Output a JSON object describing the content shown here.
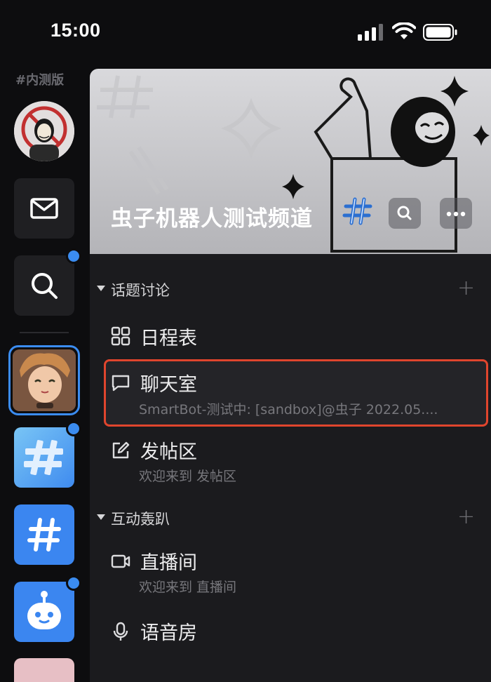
{
  "status_bar": {
    "time": "15:00"
  },
  "rail": {
    "label": "#内测版",
    "items": [
      "avatar",
      "mail",
      "search",
      "guild-1",
      "guild-2",
      "guild-3",
      "guild-4",
      "guild-5"
    ]
  },
  "channel": {
    "title": "虫子机器人测试频道"
  },
  "sections": [
    {
      "name": "话题讨论",
      "channels": [
        {
          "name": "日程表",
          "icon": "schedule-icon"
        },
        {
          "name": "聊天室",
          "icon": "chat-bubble-icon",
          "subtitle": "SmartBot-测试中: [sandbox]@虫子   2022.05...."
        },
        {
          "name": "发帖区",
          "icon": "edit-icon",
          "subtitle": "欢迎来到 发帖区"
        }
      ]
    },
    {
      "name": "互动轰趴",
      "channels": [
        {
          "name": "直播间",
          "icon": "video-icon",
          "subtitle": "欢迎来到 直播间"
        },
        {
          "name": "语音房",
          "icon": "microphone-icon"
        }
      ]
    }
  ],
  "colors": {
    "accent": "#3b8cf0",
    "highlight": "#e0452d",
    "panel": "#1b1b1e",
    "background": "#0d0d0f"
  }
}
